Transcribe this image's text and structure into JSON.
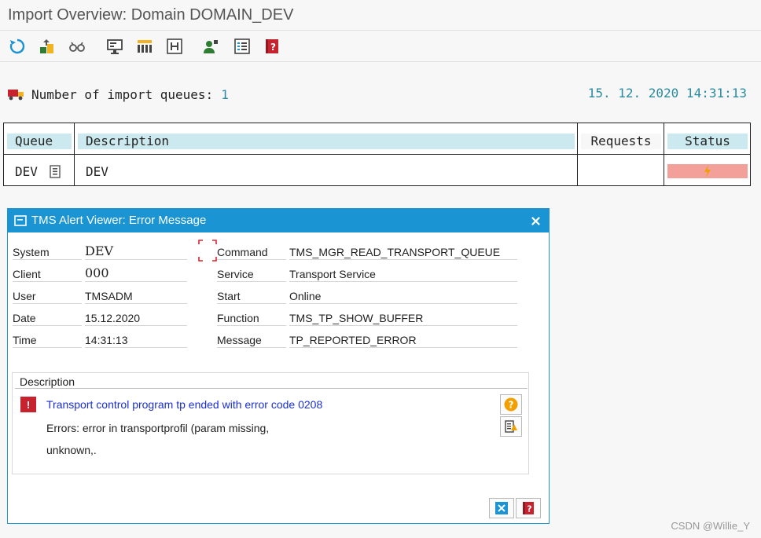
{
  "window": {
    "title": "Import Overview: Domain DOMAIN_DEV"
  },
  "toolbar": {
    "icons": [
      "refresh-icon",
      "import-queue-icon",
      "display-glasses-icon",
      "monitor-icon",
      "queue-grid-icon",
      "history-icon",
      "user-settings-icon",
      "list-icon",
      "help-book-icon"
    ]
  },
  "summary": {
    "label": "Number of import queues:",
    "count": "1",
    "timestamp": "15. 12. 2020  14:31:13"
  },
  "table": {
    "headers": {
      "queue": "Queue",
      "description": "Description",
      "requests": "Requests",
      "status": "Status"
    },
    "rows": [
      {
        "queue": "DEV",
        "description": "DEV",
        "requests": "",
        "status_color": "#f4a09a",
        "status_icon": "lightning-icon"
      }
    ]
  },
  "dialog": {
    "title": "TMS Alert Viewer: Error Message",
    "left_fields": [
      {
        "label": "System",
        "value": "DEV"
      },
      {
        "label": "Client",
        "value": "000"
      },
      {
        "label": "User",
        "value": "TMSADM"
      },
      {
        "label": "Date",
        "value": "15.12.2020"
      },
      {
        "label": "Time",
        "value": "14:31:13"
      }
    ],
    "right_fields": [
      {
        "label": "Command",
        "value": "TMS_MGR_READ_TRANSPORT_QUEUE"
      },
      {
        "label": "Service",
        "value": "Transport Service"
      },
      {
        "label": "Start",
        "value": "Online"
      },
      {
        "label": "Function",
        "value": "TMS_TP_SHOW_BUFFER"
      },
      {
        "label": "Message",
        "value": "TP_REPORTED_ERROR"
      }
    ],
    "description": {
      "label": "Description",
      "error_title": "Transport control program tp ended with error code 0208",
      "line1": "Errors: error in transportprofil (param missing,",
      "line2": "unknown,."
    }
  },
  "watermark": "CSDN @Willie_Y",
  "colors": {
    "accent": "#1a94d3",
    "header_bg": "#cbe9ee",
    "error": "#c7232f",
    "link": "#1a2fd6",
    "status_error": "#f4a09a"
  }
}
